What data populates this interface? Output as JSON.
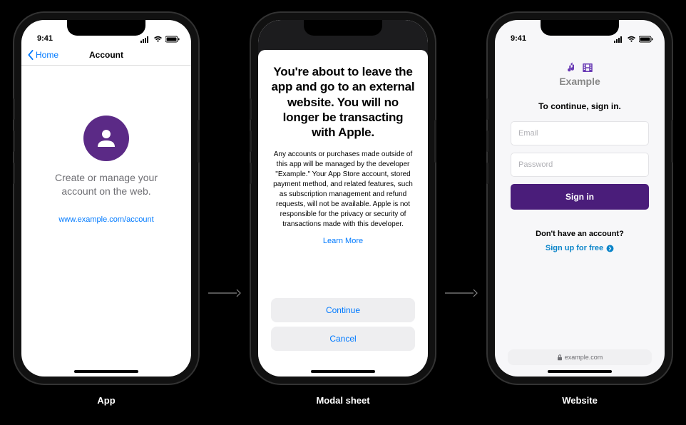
{
  "status": {
    "time": "9:41"
  },
  "phone1": {
    "back_label": "Home",
    "nav_title": "Account",
    "message": "Create or manage your account on the web.",
    "link": "www.example.com/account",
    "caption": "App"
  },
  "phone2": {
    "heading": "You're about to leave the app and go to an external website. You will no longer be transacting with Apple.",
    "body": "Any accounts or purchases made outside of this app will be managed by the developer \"Example.\" Your App Store account, stored payment method, and related features, such as subscription management and refund requests, will not be available. Apple is not responsible for the privacy or security of transactions made with this developer.",
    "learn_more": "Learn More",
    "continue": "Continue",
    "cancel": "Cancel",
    "caption": "Modal sheet"
  },
  "phone3": {
    "brand": "Example",
    "prompt": "To continue, sign in.",
    "email_placeholder": "Email",
    "password_placeholder": "Password",
    "signin_label": "Sign in",
    "no_account": "Don't have an account?",
    "signup": "Sign up for free",
    "url": "example.com",
    "caption": "Website"
  }
}
